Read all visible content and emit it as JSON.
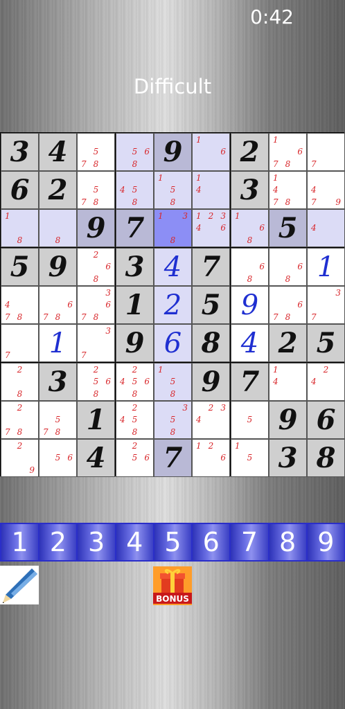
{
  "timer": "0:42",
  "difficulty": "Difficult",
  "colors": {
    "highlight": "#dcdcf6",
    "selected": "#8c8ef5",
    "given_bg": "#cfcfcf",
    "given_highlight": "#b9b9d6",
    "note": "#d8262a",
    "entered": "#1f2fd1"
  },
  "board": [
    [
      {
        "v": "3"
      },
      {
        "v": "4"
      },
      {
        "n": "578"
      },
      {
        "n": "568"
      },
      {
        "v": "9"
      },
      {
        "n": "16"
      },
      {
        "v": "2"
      },
      {
        "n": "1678"
      },
      {
        "n": "7"
      }
    ],
    [
      {
        "v": "6"
      },
      {
        "v": "2"
      },
      {
        "n": "578"
      },
      {
        "n": "458"
      },
      {
        "n": "158"
      },
      {
        "n": "14"
      },
      {
        "v": "3"
      },
      {
        "n": "1478"
      },
      {
        "n": "479"
      }
    ],
    [
      {
        "n": "18"
      },
      {
        "n": "8"
      },
      {
        "v": "9"
      },
      {
        "v": "7"
      },
      {
        "n": "138"
      },
      {
        "n": "12346"
      },
      {
        "n": "168"
      },
      {
        "v": "5"
      },
      {
        "n": "4"
      }
    ],
    [
      {
        "v": "5"
      },
      {
        "v": "9"
      },
      {
        "n": "268"
      },
      {
        "v": "3"
      },
      {
        "v": "4",
        "e": true
      },
      {
        "v": "7"
      },
      {
        "n": "68"
      },
      {
        "n": "68"
      },
      {
        "v": "1",
        "e": true
      }
    ],
    [
      {
        "n": "478"
      },
      {
        "n": "678"
      },
      {
        "n": "3678"
      },
      {
        "v": "1"
      },
      {
        "v": "2",
        "e": true
      },
      {
        "v": "5"
      },
      {
        "v": "9",
        "e": true
      },
      {
        "n": "678"
      },
      {
        "n": "37"
      }
    ],
    [
      {
        "n": "7"
      },
      {
        "v": "1",
        "e": true
      },
      {
        "n": "37"
      },
      {
        "v": "9"
      },
      {
        "v": "6",
        "e": true
      },
      {
        "v": "8"
      },
      {
        "v": "4",
        "e": true
      },
      {
        "v": "2"
      },
      {
        "v": "5"
      }
    ],
    [
      {
        "n": "28"
      },
      {
        "v": "3"
      },
      {
        "n": "2568"
      },
      {
        "n": "24568"
      },
      {
        "n": "158"
      },
      {
        "v": "9"
      },
      {
        "v": "7"
      },
      {
        "n": "14"
      },
      {
        "n": "24"
      }
    ],
    [
      {
        "n": "278"
      },
      {
        "n": "578"
      },
      {
        "v": "1"
      },
      {
        "n": "2458"
      },
      {
        "n": "358"
      },
      {
        "n": "234"
      },
      {
        "n": "5"
      },
      {
        "v": "9"
      },
      {
        "v": "6"
      }
    ],
    [
      {
        "n": "29"
      },
      {
        "n": "56"
      },
      {
        "v": "4"
      },
      {
        "n": "256"
      },
      {
        "v": "7"
      },
      {
        "n": "126"
      },
      {
        "n": "15"
      },
      {
        "v": "3"
      },
      {
        "v": "8"
      }
    ]
  ],
  "selected": {
    "row": 2,
    "col": 4
  },
  "number_bar": [
    "1",
    "2",
    "3",
    "4",
    "5",
    "6",
    "7",
    "8",
    "9"
  ],
  "tools": {
    "pen": "pen-icon",
    "bonus_label": "BONUS"
  }
}
